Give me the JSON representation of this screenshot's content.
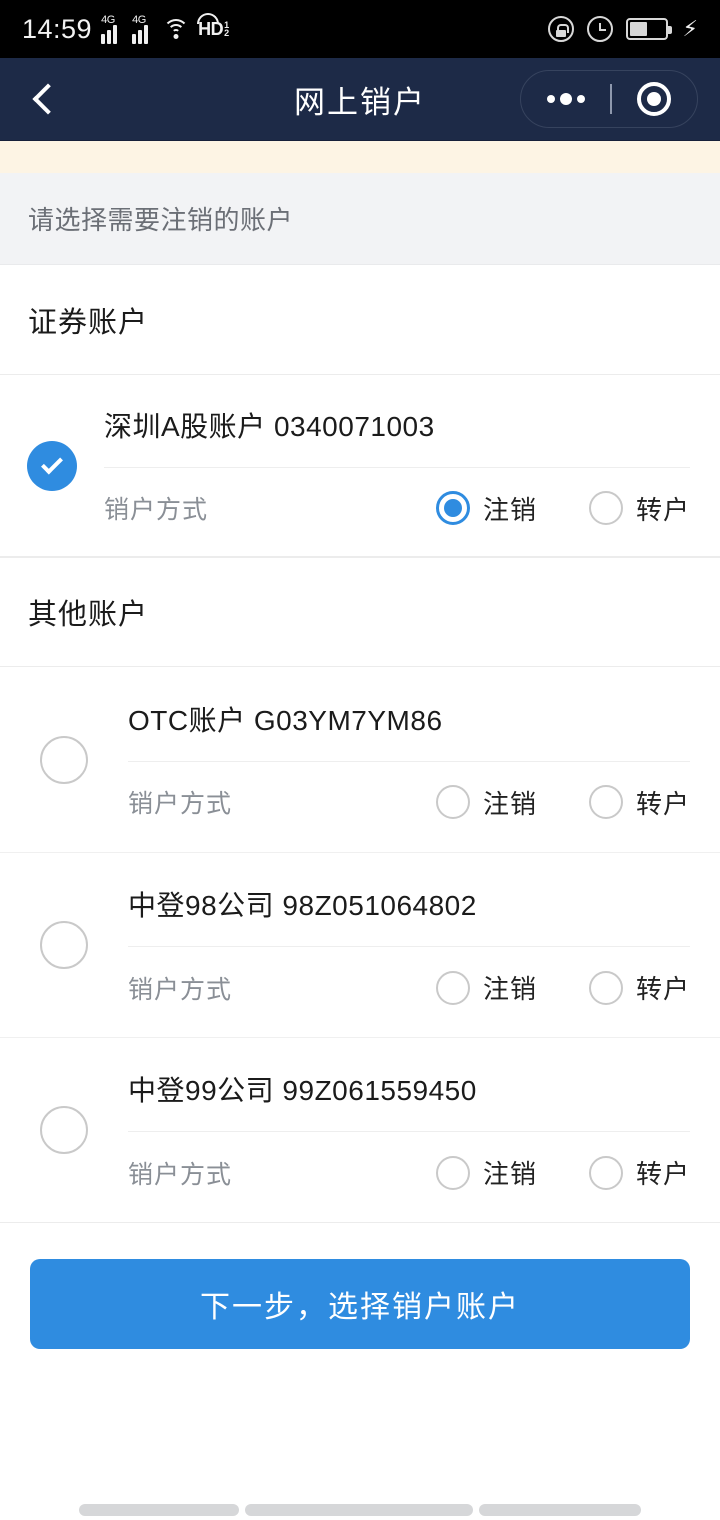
{
  "status_bar": {
    "time": "14:59",
    "network_label_1": "4G",
    "network_label_2": "4G",
    "hd_label": "HD",
    "sim_top": "1",
    "sim_bottom": "2",
    "icons": [
      "signal-4g-1",
      "signal-4g-2",
      "wifi",
      "hd-voice",
      "rotation-lock",
      "alarm",
      "battery-charging"
    ],
    "battery_percent": 50
  },
  "header": {
    "title": "网上销户",
    "back_icon": "chevron-left-icon",
    "menu_icon": "more-dots-icon",
    "close_icon": "target-circle-icon"
  },
  "notice": {
    "text": "请选择需要注销的账户"
  },
  "sections": [
    {
      "title": "证券账户"
    },
    {
      "title": "其他账户"
    }
  ],
  "securities_accounts": [
    {
      "name": "深圳A股账户 0340071003",
      "selected": true,
      "method_label": "销户方式",
      "options": [
        {
          "label": "注销",
          "selected": true
        },
        {
          "label": "转户",
          "selected": false
        }
      ]
    }
  ],
  "other_accounts": [
    {
      "name": "OTC账户 G03YM7YM86",
      "selected": false,
      "method_label": "销户方式",
      "options": [
        {
          "label": "注销",
          "selected": false
        },
        {
          "label": "转户",
          "selected": false
        }
      ]
    },
    {
      "name": "中登98公司 98Z051064802",
      "selected": false,
      "method_label": "销户方式",
      "options": [
        {
          "label": "注销",
          "selected": false
        },
        {
          "label": "转户",
          "selected": false
        }
      ]
    },
    {
      "name": "中登99公司 99Z061559450",
      "selected": false,
      "method_label": "销户方式",
      "options": [
        {
          "label": "注销",
          "selected": false
        },
        {
          "label": "转户",
          "selected": false
        }
      ]
    }
  ],
  "cta": {
    "label": "下一步，选择销户账户"
  },
  "colors": {
    "header_bg": "#1d2a47",
    "accent": "#2f8ce0",
    "cream": "#fdf4e4",
    "notice_bg": "#f2f3f5",
    "text_primary": "#1b1b1b",
    "text_muted": "#8a8f96"
  }
}
